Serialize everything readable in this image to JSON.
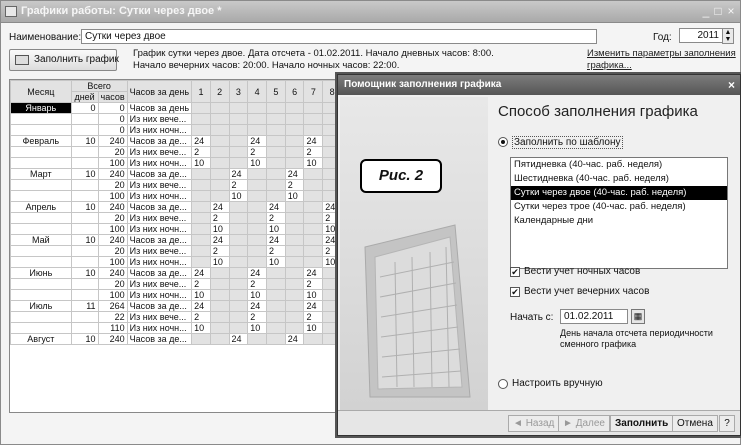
{
  "window": {
    "title": "Графики работы: Сутки через двое *",
    "min_glyph": "_",
    "max_glyph": "□",
    "close_glyph": "×"
  },
  "form": {
    "name_label": "Наименование:",
    "name_value": "Сутки через двое",
    "year_label": "Год:",
    "year_value": "2011",
    "fill_button": "Заполнить график",
    "description": "График сутки через двое. Дата отсчета - 01.02.2011. Начало дневных часов: 8:00. Начало вечерних часов: 20:00. Начало ночных часов: 22:00.",
    "change_link": "Изменить параметры заполнения графика..."
  },
  "grid": {
    "headers": {
      "month": "Месяц",
      "total": "Всего",
      "days": "дней",
      "hours": "часов",
      "hours_per_day": "Часов за день",
      "day_numbers": [
        "1",
        "2",
        "3",
        "4",
        "5",
        "6",
        "7",
        "8"
      ]
    },
    "rows": [
      {
        "month": "Январь",
        "days": "0",
        "hours": "0",
        "kind": "Часов за день",
        "d": [
          "",
          "",
          "",
          "",
          "",
          "",
          "",
          ""
        ]
      },
      {
        "month": "",
        "days": "",
        "hours": "0",
        "kind": "Из них вече...",
        "d": [
          "",
          "",
          "",
          "",
          "",
          "",
          "",
          ""
        ]
      },
      {
        "month": "",
        "days": "",
        "hours": "0",
        "kind": "Из них ночн...",
        "d": [
          "",
          "",
          "",
          "",
          "",
          "",
          "",
          ""
        ]
      },
      {
        "month": "Февраль",
        "days": "10",
        "hours": "240",
        "kind": "Часов за де...",
        "d": [
          "24",
          "",
          "",
          "24",
          "",
          "",
          "24",
          ""
        ]
      },
      {
        "month": "",
        "days": "",
        "hours": "20",
        "kind": "Из них вече...",
        "d": [
          "2",
          "",
          "",
          "2",
          "",
          "",
          "2",
          ""
        ]
      },
      {
        "month": "",
        "days": "",
        "hours": "100",
        "kind": "Из них ночн...",
        "d": [
          "10",
          "",
          "",
          "10",
          "",
          "",
          "10",
          ""
        ]
      },
      {
        "month": "Март",
        "days": "10",
        "hours": "240",
        "kind": "Часов за де...",
        "d": [
          "",
          "",
          "24",
          "",
          "",
          "24",
          "",
          ""
        ]
      },
      {
        "month": "",
        "days": "",
        "hours": "20",
        "kind": "Из них вече...",
        "d": [
          "",
          "",
          "2",
          "",
          "",
          "2",
          "",
          ""
        ]
      },
      {
        "month": "",
        "days": "",
        "hours": "100",
        "kind": "Из них ночн...",
        "d": [
          "",
          "",
          "10",
          "",
          "",
          "10",
          "",
          ""
        ]
      },
      {
        "month": "Апрель",
        "days": "10",
        "hours": "240",
        "kind": "Часов за де...",
        "d": [
          "",
          "24",
          "",
          "",
          "24",
          "",
          "",
          "24"
        ]
      },
      {
        "month": "",
        "days": "",
        "hours": "20",
        "kind": "Из них вече...",
        "d": [
          "",
          "2",
          "",
          "",
          "2",
          "",
          "",
          "2"
        ]
      },
      {
        "month": "",
        "days": "",
        "hours": "100",
        "kind": "Из них ночн...",
        "d": [
          "",
          "10",
          "",
          "",
          "10",
          "",
          "",
          "10"
        ]
      },
      {
        "month": "Май",
        "days": "10",
        "hours": "240",
        "kind": "Часов за де...",
        "d": [
          "",
          "24",
          "",
          "",
          "24",
          "",
          "",
          "24"
        ]
      },
      {
        "month": "",
        "days": "",
        "hours": "20",
        "kind": "Из них вече...",
        "d": [
          "",
          "2",
          "",
          "",
          "2",
          "",
          "",
          "2"
        ]
      },
      {
        "month": "",
        "days": "",
        "hours": "100",
        "kind": "Из них ночн...",
        "d": [
          "",
          "10",
          "",
          "",
          "10",
          "",
          "",
          "10"
        ]
      },
      {
        "month": "Июнь",
        "days": "10",
        "hours": "240",
        "kind": "Часов за де...",
        "d": [
          "24",
          "",
          "",
          "24",
          "",
          "",
          "24",
          ""
        ]
      },
      {
        "month": "",
        "days": "",
        "hours": "20",
        "kind": "Из них вече...",
        "d": [
          "2",
          "",
          "",
          "2",
          "",
          "",
          "2",
          ""
        ]
      },
      {
        "month": "",
        "days": "",
        "hours": "100",
        "kind": "Из них ночн...",
        "d": [
          "10",
          "",
          "",
          "10",
          "",
          "",
          "10",
          ""
        ]
      },
      {
        "month": "Июль",
        "days": "11",
        "hours": "264",
        "kind": "Часов за де...",
        "d": [
          "24",
          "",
          "",
          "24",
          "",
          "",
          "24",
          ""
        ]
      },
      {
        "month": "",
        "days": "",
        "hours": "22",
        "kind": "Из них вече...",
        "d": [
          "2",
          "",
          "",
          "2",
          "",
          "",
          "2",
          ""
        ]
      },
      {
        "month": "",
        "days": "",
        "hours": "110",
        "kind": "Из них ночн...",
        "d": [
          "10",
          "",
          "",
          "10",
          "",
          "",
          "10",
          ""
        ]
      },
      {
        "month": "Август",
        "days": "10",
        "hours": "240",
        "kind": "Часов за де...",
        "d": [
          "",
          "",
          "24",
          "",
          "",
          "24",
          "",
          ""
        ]
      }
    ]
  },
  "dialog": {
    "title": "Помощник заполнения графика",
    "close_glyph": "×",
    "figure_label": "Рис. 2",
    "heading": "Способ заполнения графика",
    "by_template_label": "Заполнить по шаблону",
    "templates": [
      "Пятидневка (40-час. раб. неделя)",
      "Шестидневка (40-час. раб. неделя)",
      "Сутки через двое (40-час. раб. неделя)",
      "Сутки через трое (40-час. раб. неделя)",
      "Календарные дни"
    ],
    "selected_template_index": 2,
    "night_hours_label": "Вести учет ночных часов",
    "evening_hours_label": "Вести учет вечерних часов",
    "start_label": "Начать с:",
    "start_value": "01.02.2011",
    "start_hint": "День начала отсчета периодичности сменного графика",
    "manual_label": "Настроить вручную",
    "footer": {
      "back": "Назад",
      "next": "Далее",
      "fill": "Заполнить",
      "cancel": "Отмена",
      "help": "?"
    }
  }
}
